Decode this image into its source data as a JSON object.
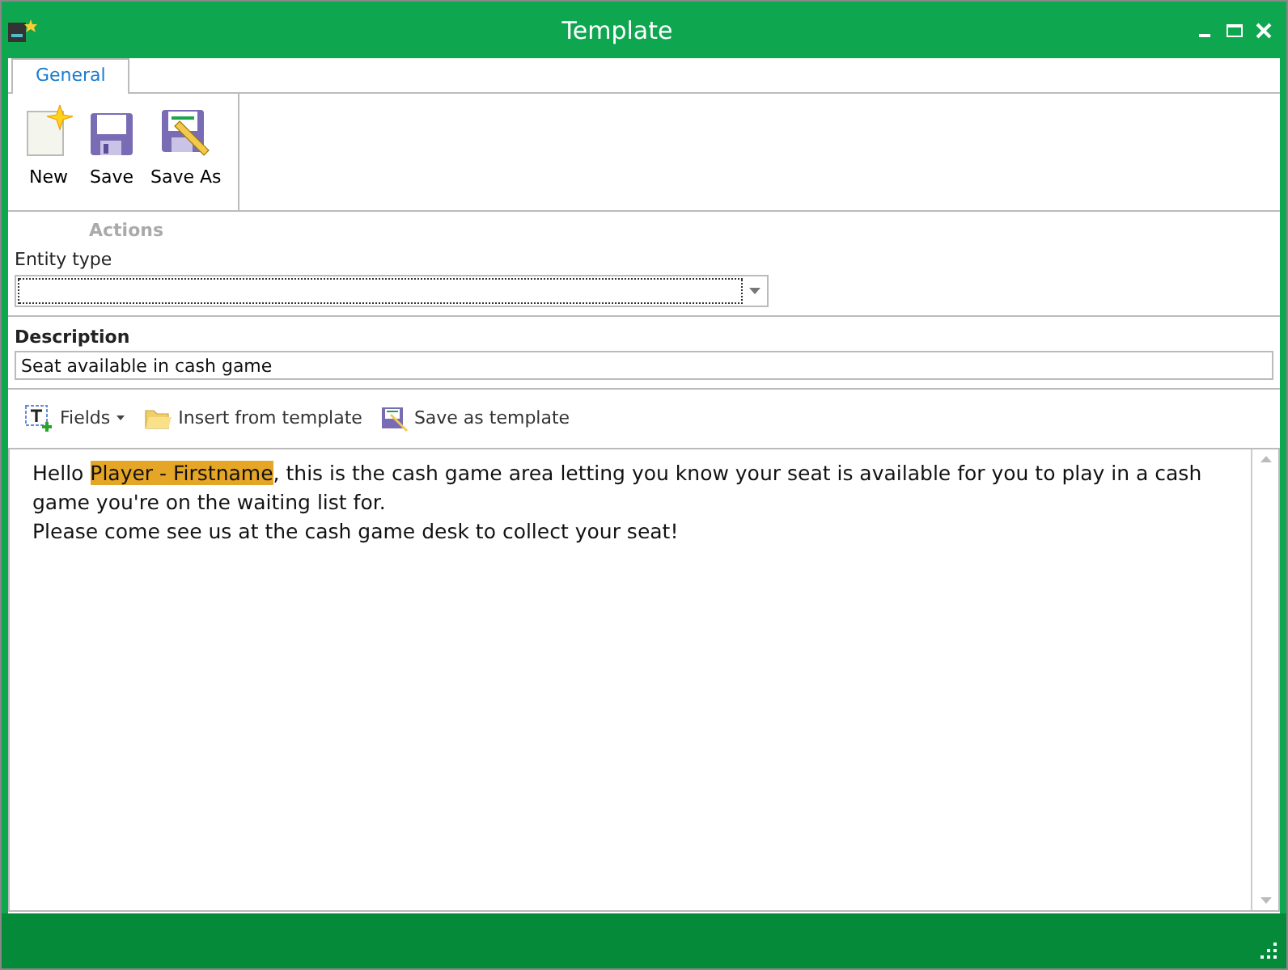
{
  "window": {
    "title": "Template"
  },
  "tabs": [
    {
      "label": "General",
      "selected": true
    }
  ],
  "ribbon": {
    "buttons": [
      {
        "kind": "new",
        "label": "New"
      },
      {
        "kind": "save",
        "label": "Save"
      },
      {
        "kind": "saveas",
        "label": "Save As"
      }
    ],
    "group_label": "Actions"
  },
  "entity_type": {
    "label": "Entity type"
  },
  "description": {
    "label": "Description",
    "value": "Seat available in cash game"
  },
  "toolbar": [
    {
      "kind": "fields",
      "label": "Fields"
    },
    {
      "kind": "insert",
      "label": "Insert from template"
    },
    {
      "kind": "savetpl",
      "label": "Save as template"
    }
  ],
  "editor": {
    "paragraphs": [
      {
        "segments": [
          {
            "kind": "text",
            "text": "Hello "
          },
          {
            "kind": "field",
            "text": "Player - Firstname"
          },
          {
            "kind": "text",
            "text": ", this is the cash game area letting you know your seat is available for you to play in a cash game you're on the waiting list for."
          }
        ]
      },
      {
        "segments": [
          {
            "kind": "text",
            "text": "Please come see us at the cash game desk to collect your seat!"
          }
        ]
      }
    ]
  }
}
